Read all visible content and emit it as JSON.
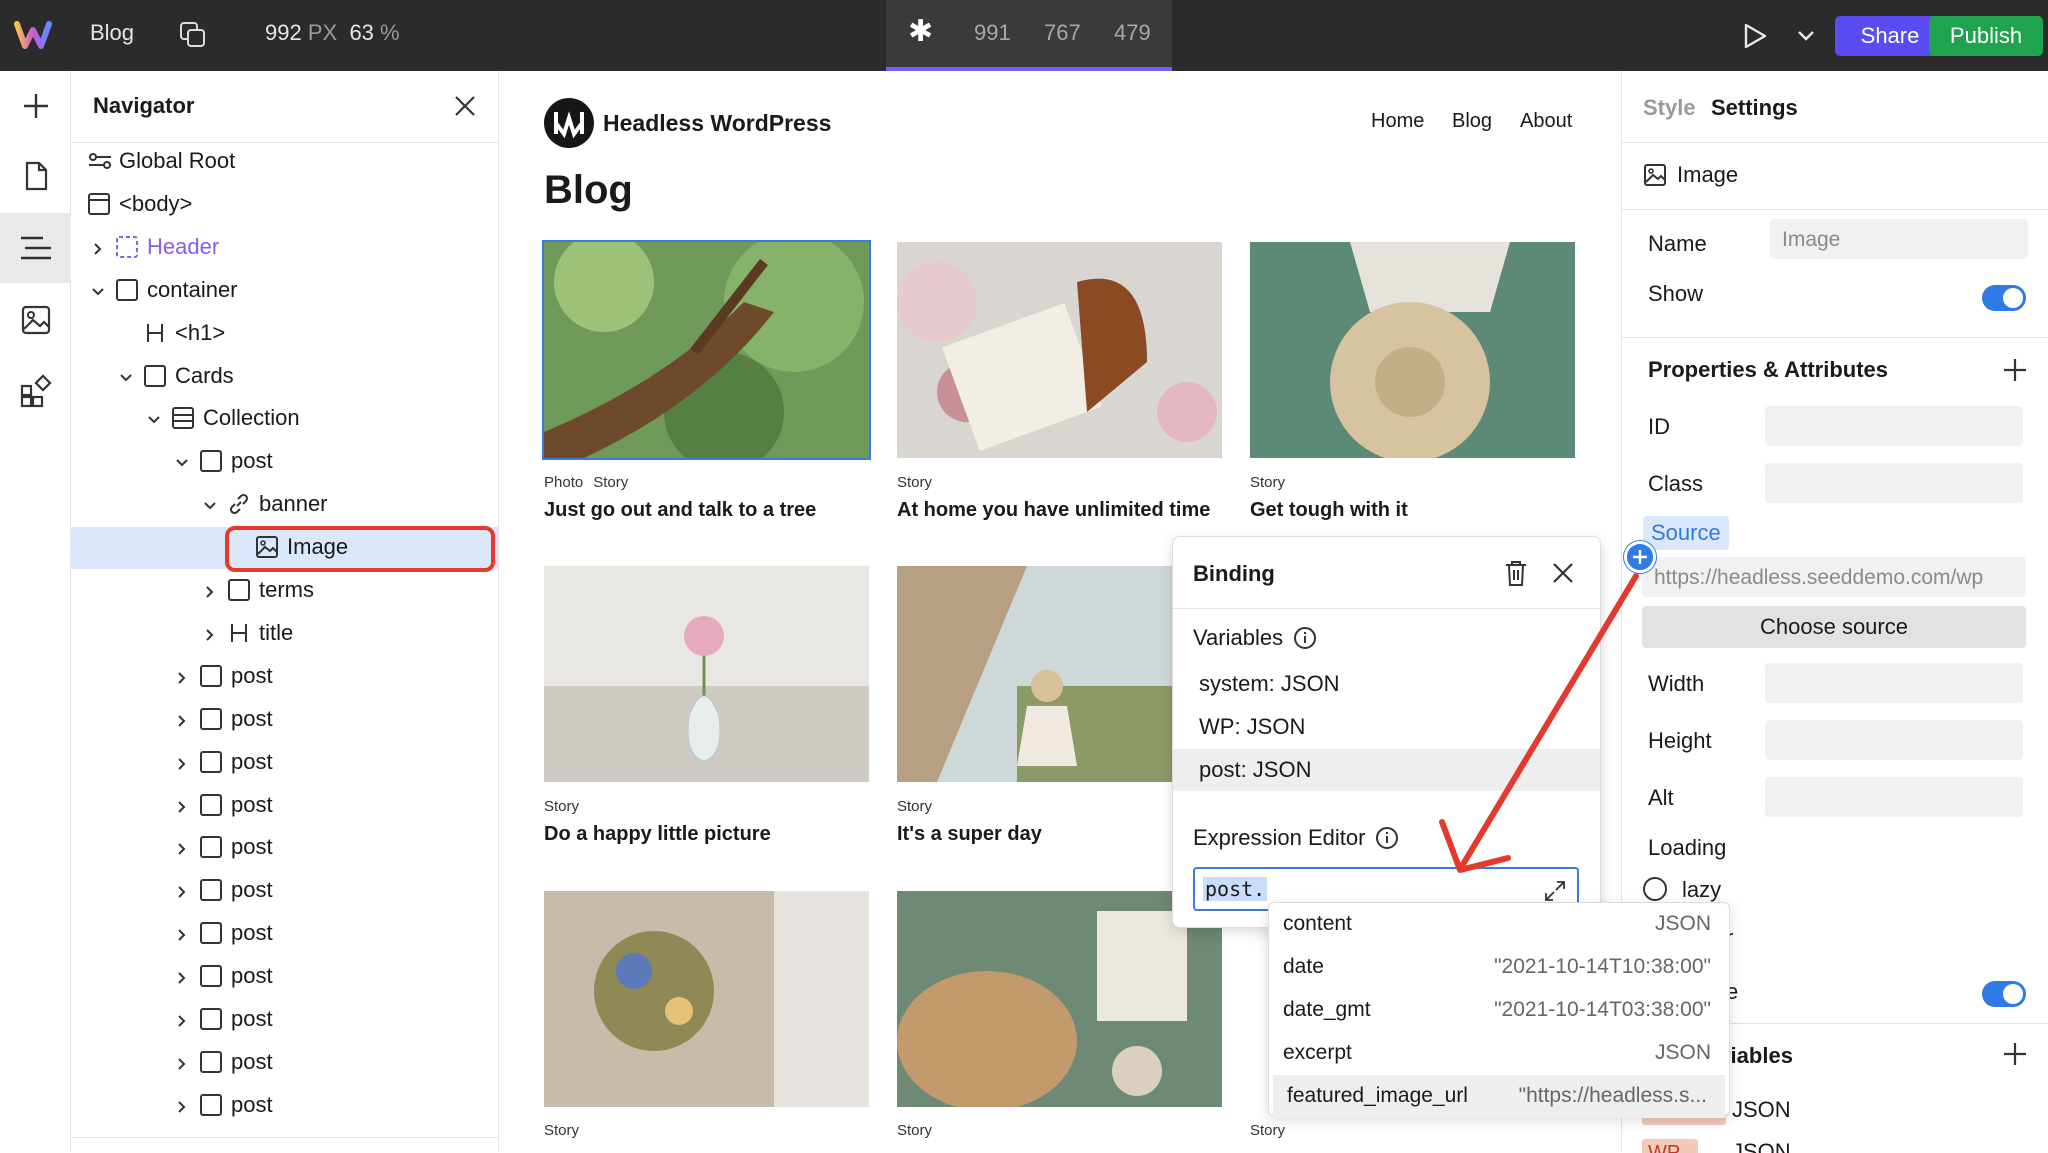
{
  "topbar": {
    "page_name": "Blog",
    "size_value": "992",
    "size_unit": "PX",
    "zoom_value": "63",
    "zoom_unit": "%",
    "breakpoints": [
      "991",
      "767",
      "479"
    ],
    "share_label": "Share",
    "publish_label": "Publish"
  },
  "navigator": {
    "title": "Navigator",
    "tree": [
      {
        "label": "Global Root",
        "icon": "global-root-icon",
        "indent": 0,
        "caret": "none"
      },
      {
        "label": "<body>",
        "icon": "body-icon",
        "indent": 0,
        "caret": "none"
      },
      {
        "label": "Header",
        "icon": "component-icon",
        "indent": 1,
        "caret": "right"
      },
      {
        "label": "container",
        "icon": "box-icon",
        "indent": 1,
        "caret": "down"
      },
      {
        "label": "<h1>",
        "icon": "heading-icon",
        "indent": 2,
        "caret": "none"
      },
      {
        "label": "Cards",
        "icon": "box-icon",
        "indent": 2,
        "caret": "down"
      },
      {
        "label": "Collection",
        "icon": "collection-icon",
        "indent": 3,
        "caret": "down"
      },
      {
        "label": "post",
        "icon": "box-icon",
        "indent": 4,
        "caret": "down"
      },
      {
        "label": "banner",
        "icon": "link-icon",
        "indent": 5,
        "caret": "down"
      },
      {
        "label": "Image",
        "icon": "image-icon",
        "indent": 6,
        "caret": "none"
      },
      {
        "label": "terms",
        "icon": "box-icon",
        "indent": 5,
        "caret": "right"
      },
      {
        "label": "title",
        "icon": "heading-icon",
        "indent": 5,
        "caret": "right"
      },
      {
        "label": "post",
        "icon": "box-icon",
        "indent": 4,
        "caret": "right"
      },
      {
        "label": "post",
        "icon": "box-icon",
        "indent": 4,
        "caret": "right"
      },
      {
        "label": "post",
        "icon": "box-icon",
        "indent": 4,
        "caret": "right"
      },
      {
        "label": "post",
        "icon": "box-icon",
        "indent": 4,
        "caret": "right"
      },
      {
        "label": "post",
        "icon": "box-icon",
        "indent": 4,
        "caret": "right"
      },
      {
        "label": "post",
        "icon": "box-icon",
        "indent": 4,
        "caret": "right"
      },
      {
        "label": "post",
        "icon": "box-icon",
        "indent": 4,
        "caret": "right"
      },
      {
        "label": "post",
        "icon": "box-icon",
        "indent": 4,
        "caret": "right"
      },
      {
        "label": "post",
        "icon": "box-icon",
        "indent": 4,
        "caret": "right"
      },
      {
        "label": "post",
        "icon": "box-icon",
        "indent": 4,
        "caret": "right"
      },
      {
        "label": "post",
        "icon": "box-icon",
        "indent": 4,
        "caret": "right"
      }
    ]
  },
  "site": {
    "title": "Headless WordPress",
    "nav": [
      "Home",
      "Blog",
      "About"
    ],
    "heading": "Blog",
    "cards": [
      {
        "tags": [
          "Photo",
          "Story"
        ],
        "title": "Just go out and talk to a tree",
        "image": "tree-photo"
      },
      {
        "tags": [
          "Story"
        ],
        "title": "At home you have unlimited time",
        "image": "book-bag-photo"
      },
      {
        "tags": [
          "Story"
        ],
        "title": "Get tough with it",
        "image": "straw-hat-photo"
      },
      {
        "tags": [
          "Story"
        ],
        "title": "Do a happy little picture",
        "image": "vase-flower-photo"
      },
      {
        "tags": [
          "Story"
        ],
        "title": "It's a super day",
        "image": "tent-lake-photo"
      },
      {
        "tags": [
          "Story"
        ],
        "title": "",
        "image": "dried-flowers-photo"
      },
      {
        "tags": [
          "Story"
        ],
        "title": "",
        "image": "basket-flatlay-photo"
      },
      {
        "tags": [
          "Story"
        ],
        "title": "",
        "image": "hidden"
      }
    ]
  },
  "binding": {
    "title": "Binding",
    "variables_label": "Variables",
    "variables": [
      "system: JSON",
      "WP: JSON",
      "post: JSON"
    ],
    "expression_label": "Expression Editor",
    "expression_value": "post."
  },
  "autocomplete": [
    {
      "key": "content",
      "value": "JSON"
    },
    {
      "key": "date",
      "value": "\"2021-10-14T10:38:00\""
    },
    {
      "key": "date_gmt",
      "value": "\"2021-10-14T03:38:00\""
    },
    {
      "key": "excerpt",
      "value": "JSON"
    },
    {
      "key": "featured_image_url",
      "value": "\"https://headless.s..."
    }
  ],
  "right_panel": {
    "tabs": [
      "Style",
      "Settings"
    ],
    "element_type": "Image",
    "name_label": "Name",
    "name_placeholder": "Image",
    "show_label": "Show",
    "props_title": "Properties & Attributes",
    "id_label": "ID",
    "class_label": "Class",
    "source_label": "Source",
    "source_value": "https://headless.seeddemo.com/wp",
    "choose_source_label": "Choose source",
    "width_label": "Width",
    "height_label": "Height",
    "alt_label": "Alt",
    "loading_label": "Loading",
    "loading_option": "lazy",
    "partial_option": "r",
    "partial_row": "e",
    "variables_partial": "riables",
    "var_json": "JSON",
    "wp_partial": "WP",
    "wp_json": "JSON"
  },
  "colors": {
    "accent_blue": "#2f7ae5",
    "share_purple": "#5a4cf0",
    "publish_green": "#1fa34e",
    "annotation_red": "#e33a2c",
    "breakpoint_underline": "#7b5cff"
  }
}
